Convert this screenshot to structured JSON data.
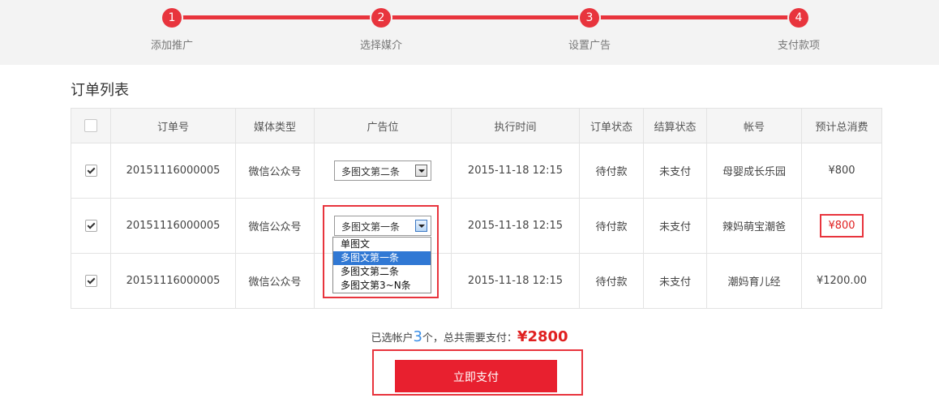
{
  "steps": [
    {
      "number": "1",
      "label": "添加推广"
    },
    {
      "number": "2",
      "label": "选择媒介"
    },
    {
      "number": "3",
      "label": "设置广告"
    },
    {
      "number": "4",
      "label": "支付款项"
    }
  ],
  "section_title": "订单列表",
  "table": {
    "headers": [
      "订单号",
      "媒体类型",
      "广告位",
      "执行时间",
      "订单状态",
      "结算状态",
      "帐号",
      "预计总消费"
    ],
    "rows": [
      {
        "checked": true,
        "order_no": "20151116000005",
        "media_type": "微信公众号",
        "ad_slot": "多图文第二条",
        "exec_time": "2015-11-18 12:15",
        "order_status": "待付款",
        "settle_status": "未支付",
        "account": "母婴成长乐园",
        "total": "¥800"
      },
      {
        "checked": true,
        "order_no": "20151116000005",
        "media_type": "微信公众号",
        "ad_slot": "多图文第一条",
        "exec_time": "2015-11-18 12:15",
        "order_status": "待付款",
        "settle_status": "未支付",
        "account": "辣妈萌宝潮爸",
        "total": "¥800"
      },
      {
        "checked": true,
        "order_no": "20151116000005",
        "media_type": "微信公众号",
        "ad_slot": "",
        "exec_time": "2015-11-18 12:15",
        "order_status": "待付款",
        "settle_status": "未支付",
        "account": "潮妈育儿经",
        "total": "¥1200.00"
      }
    ]
  },
  "dropdown": {
    "options": [
      "单图文",
      "多图文第一条",
      "多图文第二条",
      "多图文第3~N条"
    ],
    "selected": "多图文第一条"
  },
  "summary": {
    "prefix": "已选帐户",
    "count": "3",
    "middle": "个，总共需要支付：",
    "total": "¥2800"
  },
  "pay_button_label": "立即支付",
  "colors": {
    "accent": "#e8343d",
    "link": "#3a8ee6",
    "price": "#e02020"
  }
}
